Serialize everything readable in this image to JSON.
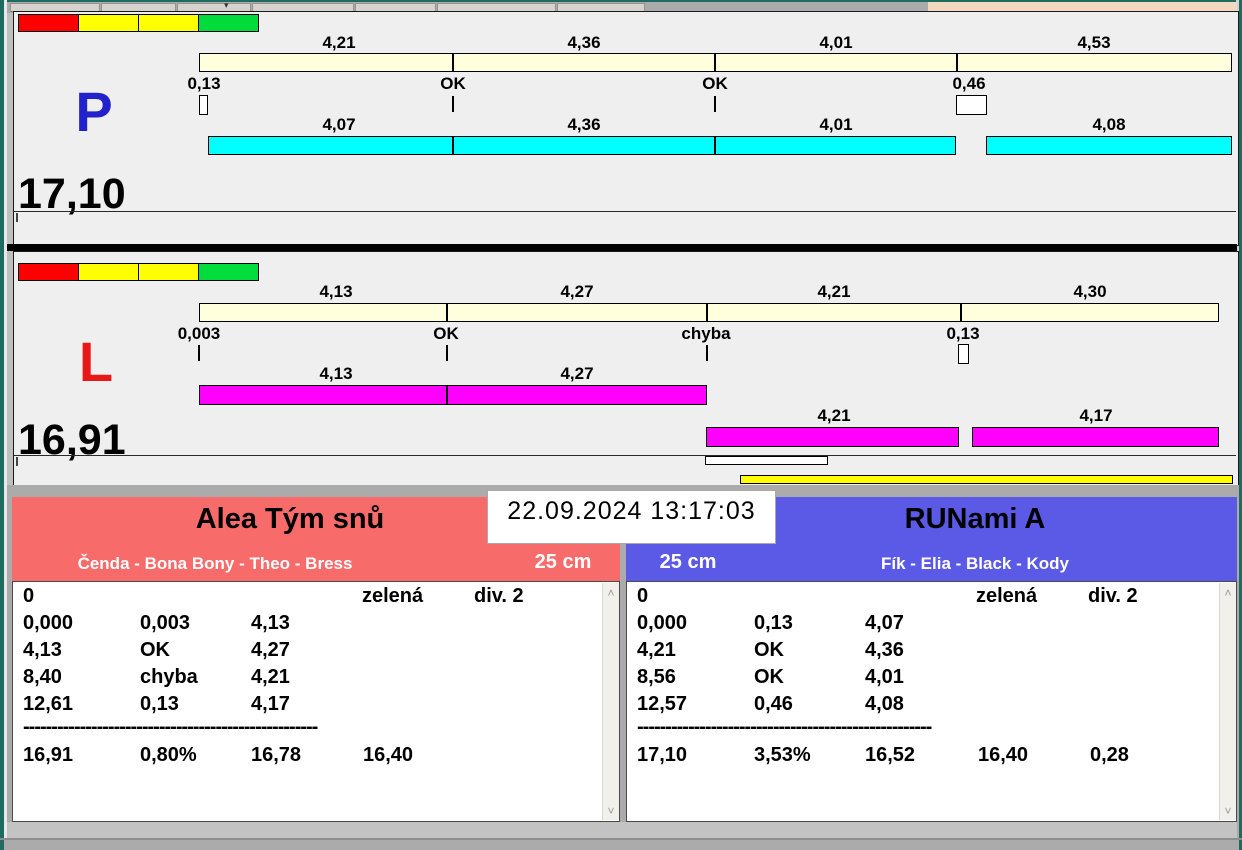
{
  "icons": {
    "dropdown": "▾",
    "scroll_up": "˄",
    "scroll_down": "˅"
  },
  "colors": {
    "cream_bar": "#FFFFDE",
    "cyan_bar": "#00FFFF",
    "magenta_bar": "#FF00FF",
    "yellow_bar": "#FFFF00",
    "light_red": "#FF0000",
    "light_yellow": "#FFFF00",
    "light_green": "#00DC3C",
    "team_left_bg": "#F76B6B",
    "team_right_bg": "#5A5AE6",
    "p_letter": "#2222CC",
    "l_letter": "#E81818",
    "window_border": "#1E6B60",
    "top_right_panel": "#F2D8BE"
  },
  "p_section": {
    "label": "P",
    "total": "17,10",
    "plan_labels": [
      "4,21",
      "4,36",
      "4,01",
      "4,53"
    ],
    "change_labels": [
      "0,13",
      "OK",
      "OK",
      "0,46"
    ],
    "run_labels": [
      "4,07",
      "4,36",
      "4,01",
      "4,08"
    ]
  },
  "l_section": {
    "label": "L",
    "total": "16,91",
    "plan_labels": [
      "4,13",
      "4,27",
      "4,21",
      "4,30"
    ],
    "change_labels": [
      "0,003",
      "OK",
      "chyba",
      "0,13"
    ],
    "run_labels_row1": [
      "4,13",
      "4,27"
    ],
    "run_labels_row2": [
      "4,21",
      "4,17"
    ]
  },
  "timestamp": "22.09.2024 13:17:03",
  "left_team": {
    "name": "Alea Tým snů",
    "members": "Čenda - Bona Bony - Theo - Bress",
    "category": "25 cm",
    "table": {
      "rows": [
        [
          "0",
          "",
          "",
          "zelená",
          "div. 2"
        ],
        [
          "0,000",
          "0,003",
          "4,13",
          "",
          ""
        ],
        [
          "4,13",
          "OK",
          "4,27",
          "",
          ""
        ],
        [
          "8,40",
          "chyba",
          "4,21",
          "",
          ""
        ],
        [
          "12,61",
          "0,13",
          "4,17",
          "",
          ""
        ]
      ],
      "separator": "----------------------------------------------------",
      "totals": [
        "16,91",
        "0,80%",
        "16,78",
        "16,40",
        ""
      ]
    }
  },
  "right_team": {
    "name": "RUNami A",
    "members": "Fík - Elia - Black - Kody",
    "category": "25 cm",
    "table": {
      "rows": [
        [
          "0",
          "",
          "",
          "zelená",
          "div. 2"
        ],
        [
          "0,000",
          "0,13",
          "4,07",
          "",
          ""
        ],
        [
          "4,21",
          "OK",
          "4,36",
          "",
          ""
        ],
        [
          "8,56",
          "OK",
          "4,01",
          "",
          ""
        ],
        [
          "12,57",
          "0,46",
          "4,08",
          "",
          ""
        ]
      ],
      "separator": "----------------------------------------------------",
      "totals": [
        "17,10",
        "3,53%",
        "16,52",
        "16,40",
        "0,28"
      ]
    }
  }
}
